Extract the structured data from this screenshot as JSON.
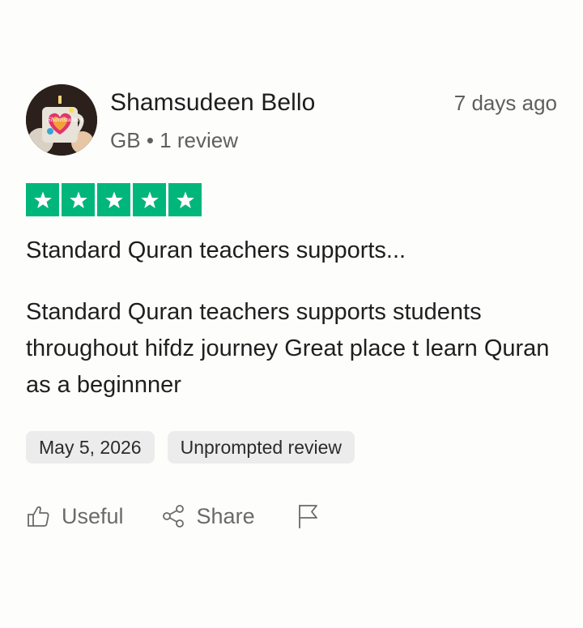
{
  "review": {
    "reviewer": {
      "name": "Shamsudeen Bello",
      "country": "GB",
      "separator": "•",
      "review_count": "1 review",
      "avatar_text": "Shamsudeen"
    },
    "time_ago": "7 days ago",
    "rating": {
      "stars": 5,
      "max": 5,
      "color": "#00b67a"
    },
    "title": "Standard Quran teachers supports...",
    "body": "Standard Quran teachers supports students throughout hifdz journey Great place t learn Quran as a beginnner",
    "tags": {
      "date": "May 5, 2026",
      "type": "Unprompted review"
    },
    "actions": {
      "useful_label": "Useful",
      "share_label": "Share",
      "useful_icon": "thumbs-up-icon",
      "share_icon": "share-icon",
      "report_icon": "flag-icon"
    }
  }
}
